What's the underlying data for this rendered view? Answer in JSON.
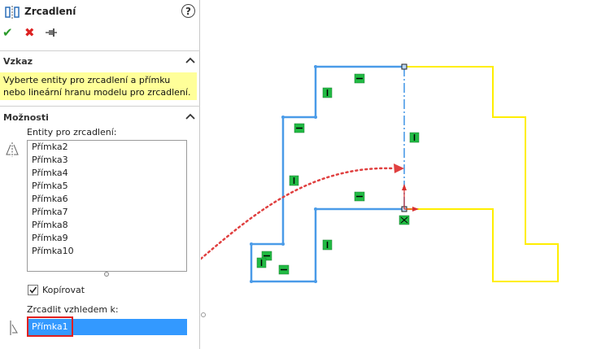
{
  "panel": {
    "title": "Zrcadlení",
    "help_label": "?",
    "actions": {
      "ok": "✔",
      "cancel": "✖"
    }
  },
  "message_group": {
    "title": "Vzkaz",
    "text": "Vyberte entity pro zrcadlení a přímku nebo lineární hranu modelu pro zrcadlení."
  },
  "options_group": {
    "title": "Možnosti",
    "entities_label": "Entity pro zrcadlení:",
    "entities": [
      "Přímka2",
      "Přímka3",
      "Přímka4",
      "Přímka5",
      "Přímka6",
      "Přímka7",
      "Přímka8",
      "Přímka9",
      "Přímka10"
    ],
    "copy_label": "Kopírovat",
    "copy_checked": true,
    "mirror_about_label": "Zrcadlit vzhledem k:",
    "mirror_about_value": "Přímka1"
  },
  "colors": {
    "sketch_selected": "#4a9be8",
    "sketch_mirrored": "#ffee00",
    "relation_green": "#22bb44",
    "arrow_red": "#d83030"
  }
}
